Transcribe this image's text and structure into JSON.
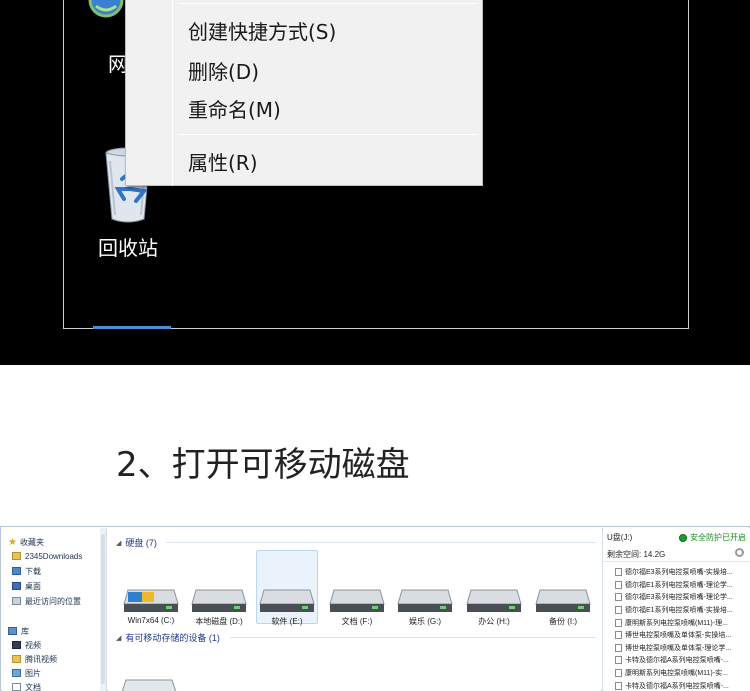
{
  "screenshot1": {
    "desktop_icons": [
      {
        "label": "网",
        "icon": "network-icon"
      },
      {
        "label": "回收站",
        "icon": "recycle-bin-icon"
      }
    ],
    "context_menu": {
      "items": [
        "创建快捷方式(S)",
        "删除(D)",
        "重命名(M)",
        "属性(R)"
      ]
    }
  },
  "step_title": "2、打开可移动磁盘",
  "screenshot2": {
    "nav": {
      "favorites": "收藏夹",
      "items": [
        "2345Downloads",
        "下载",
        "桌面",
        "最近访问的位置"
      ],
      "library": "库",
      "library_items": [
        "视频",
        "腾讯视频",
        "图片",
        "文档"
      ]
    },
    "groups": {
      "hard_disks": "硬盘 (7)",
      "removable": "有可移动存储的设备 (1)"
    },
    "drives": [
      "Win7x64 (C:)",
      "本地磁盘 (D:)",
      "软件 (E:)",
      "文档 (F:)",
      "娱乐 (G:)",
      "办公 (H:)",
      "备份 (I:)"
    ],
    "details": {
      "drive_name": "U盘(J:)",
      "protection": "安全防护已开启",
      "free_space": "剩余空间: 14.2G",
      "files": [
        "德尔福E3系列电控泵喷嘴-实操培...",
        "德尔福E1系列电控泵喷嘴-理论学...",
        "德尔福E3系列电控泵喷嘴-理论学...",
        "德尔福E1系列电控泵喷嘴-实操培...",
        "康明斯系列电控泵喷嘴(M11)-理...",
        "博世电控泵喷嘴及单体泵-实操培...",
        "博世电控泵喷嘴及单体泵-理论学...",
        "卡特及德尔福A系列电控泵喷嘴-...",
        "康明斯系列电控泵喷嘴(M11)-实...",
        "卡特及德尔福A系列电控泵喷嘴-..."
      ]
    }
  }
}
